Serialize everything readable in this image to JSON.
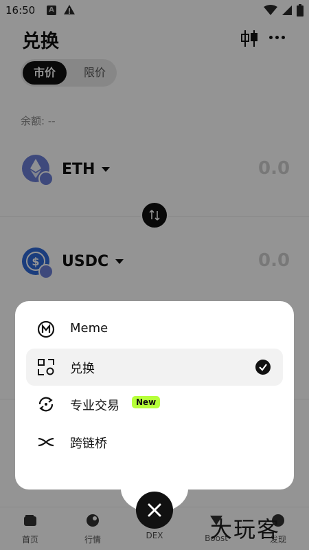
{
  "status_bar": {
    "time": "16:50",
    "a_badge": "A"
  },
  "header": {
    "title": "兑换"
  },
  "segmented": {
    "active": "市价",
    "inactive": "限价"
  },
  "balance": {
    "text": "余额: --"
  },
  "from_token": {
    "symbol": "ETH",
    "amount": "0.0",
    "color": "#6b7fd6"
  },
  "to_token": {
    "symbol": "USDC",
    "amount": "0.0",
    "color": "#2f6ad8"
  },
  "menu": {
    "items": [
      {
        "label": "Meme",
        "icon": "meme-icon",
        "selected": false
      },
      {
        "label": "兑换",
        "icon": "swap-grid-icon",
        "selected": true
      },
      {
        "label": "专业交易",
        "icon": "pro-trade-icon",
        "selected": false,
        "badge": "New"
      },
      {
        "label": "跨链桥",
        "icon": "bridge-icon",
        "selected": false
      }
    ]
  },
  "bottom_nav": {
    "items": [
      {
        "label": "首页"
      },
      {
        "label": "行情"
      },
      {
        "label": "DEX"
      },
      {
        "label": "Boost"
      },
      {
        "label": "发现"
      }
    ]
  },
  "watermark": {
    "text": "大玩客"
  },
  "colors": {
    "accent_new": "#b6ff3a",
    "dark": "#111111"
  }
}
